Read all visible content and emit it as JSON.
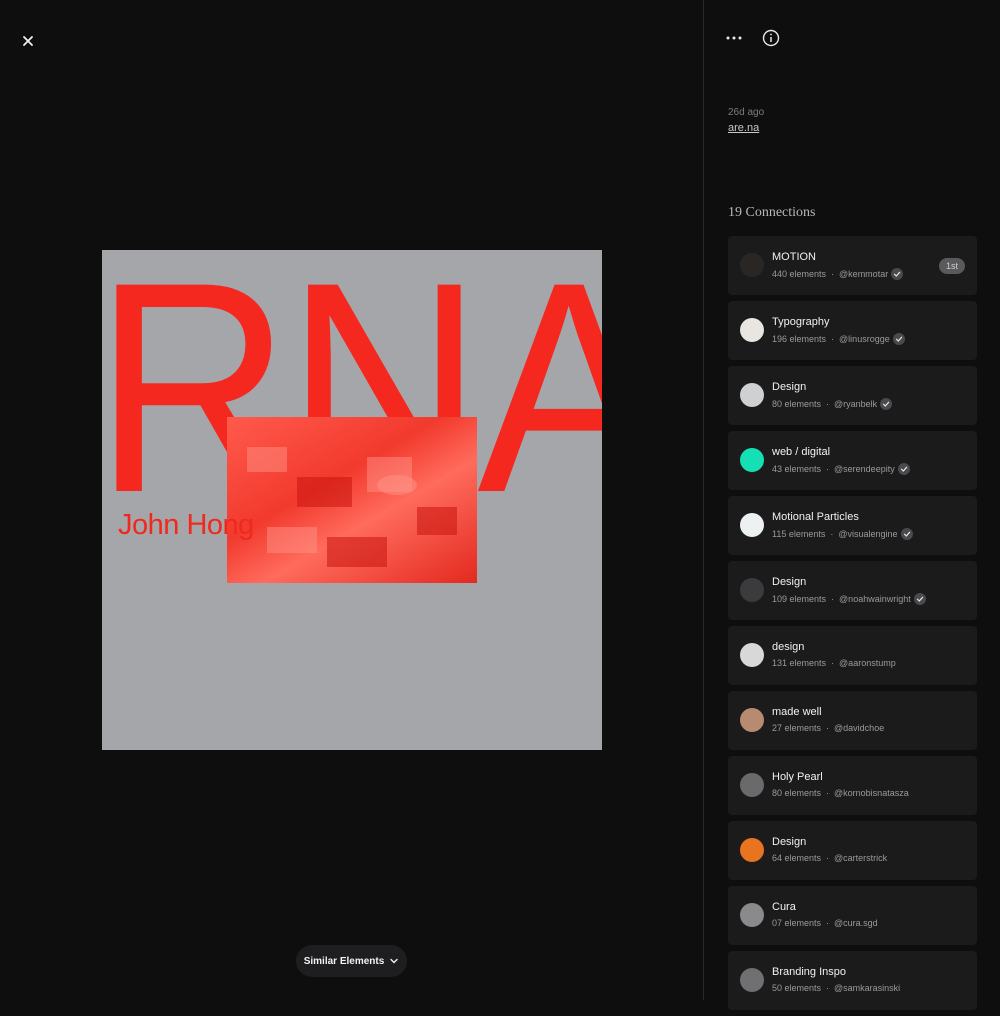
{
  "viewer": {
    "close_icon": "close-icon",
    "artwork": {
      "headline": "RNA",
      "name": "John Hong"
    },
    "similar_button": {
      "label": "Similar Elements",
      "icon": "chevron-down-icon"
    }
  },
  "panel": {
    "actions": {
      "more_icon": "more-icon",
      "info_icon": "info-icon"
    },
    "meta": {
      "time": "26d ago",
      "source": "are.na"
    },
    "connections_title": "19 Connections",
    "connections": [
      {
        "name": "MOTION",
        "count": "440 elements",
        "user": "@kemmotar",
        "verified": true,
        "badge": "1st",
        "avatar_color": "#2a2624"
      },
      {
        "name": "Typography",
        "count": "196 elements",
        "user": "@linusrogge",
        "verified": true,
        "badge": "",
        "avatar_color": "#e9e6e2"
      },
      {
        "name": "Design",
        "count": "80 elements",
        "user": "@ryanbelk",
        "verified": true,
        "badge": "",
        "avatar_color": "#cfd0d2"
      },
      {
        "name": "web / digital",
        "count": "43 elements",
        "user": "@serendeepity",
        "verified": true,
        "badge": "",
        "avatar_color": "#14e0b4"
      },
      {
        "name": "Motional Particles",
        "count": "115 elements",
        "user": "@visualengine",
        "verified": true,
        "badge": "",
        "avatar_color": "#eef1f1"
      },
      {
        "name": "Design",
        "count": "109 elements",
        "user": "@noahwainwright",
        "verified": true,
        "badge": "",
        "avatar_color": "#3b3b3d"
      },
      {
        "name": "design",
        "count": "131 elements",
        "user": "@aaronstump",
        "verified": false,
        "badge": "",
        "avatar_color": "#d8d8d8"
      },
      {
        "name": "made well",
        "count": "27 elements",
        "user": "@davidchoe",
        "verified": false,
        "badge": "",
        "avatar_color": "#b98a72"
      },
      {
        "name": "Holy Pearl",
        "count": "80 elements",
        "user": "@kornobisnatasza",
        "verified": false,
        "badge": "",
        "avatar_color": "#6a6a6d"
      },
      {
        "name": "Design",
        "count": "64 elements",
        "user": "@carterstrick",
        "verified": false,
        "badge": "",
        "avatar_color": "#e8741f"
      },
      {
        "name": "Cura",
        "count": "07 elements",
        "user": "@cura.sgd",
        "verified": false,
        "badge": "",
        "avatar_color": "#8a8a8c"
      },
      {
        "name": "Branding Inspo",
        "count": "50 elements",
        "user": "@samkarasinski",
        "verified": false,
        "badge": "",
        "avatar_color": "#707073"
      }
    ]
  }
}
